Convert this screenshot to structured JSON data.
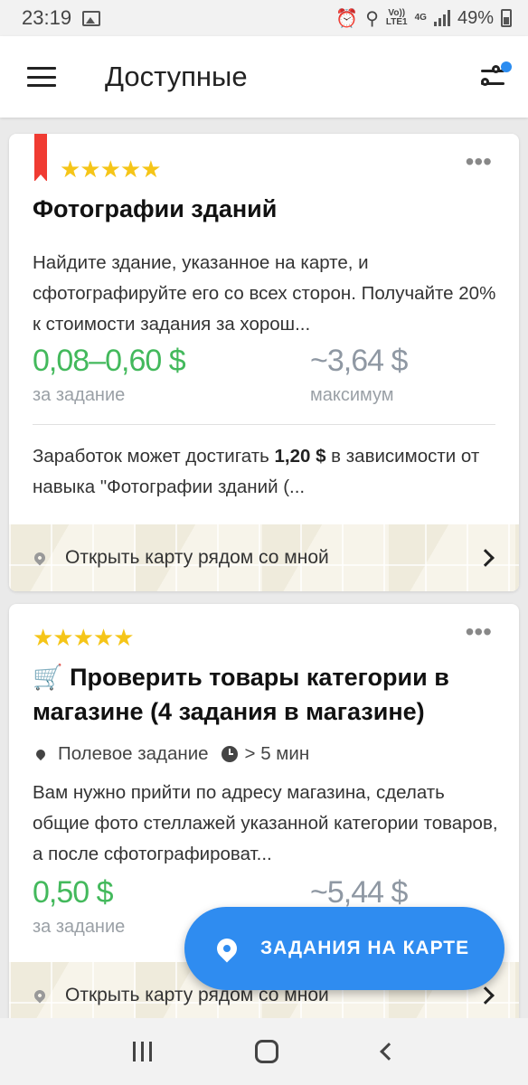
{
  "status_bar": {
    "time": "23:19",
    "network_top": "Vo))",
    "network_bottom": "LTE1",
    "net_type": "4G",
    "battery": "49%"
  },
  "app_bar": {
    "title": "Доступные"
  },
  "cards": [
    {
      "stars": "★★★★★",
      "title": "Фотографии зданий",
      "description": "Найдите здание, указанное на карте, и сфотографируйте его со всех сторон. Получайте 20% к стоимости задания за хорош...",
      "price": "0,08–0,60 $",
      "price_label": "за задание",
      "max_price": "~3,64 $",
      "max_label": "максимум",
      "earn_prefix": "Заработок может достигать ",
      "earn_amount": "1,20 $",
      "earn_suffix": " в зависимости от навыка \"Фотографии зданий (...",
      "map_link": "Открыть карту рядом со мной"
    },
    {
      "stars": "★★★★★",
      "title": "🛒 Проверить товары категории в магазине (4 задания в магазине)",
      "meta_type": "Полевое задание",
      "meta_time": "> 5 мин",
      "description": "Вам нужно прийти по адресу магазина, сделать общие фото стеллажей указанной категории товаров, а после сфотографироват...",
      "price": "0,50 $",
      "price_label": "за задание",
      "max_price": "~5,44 $",
      "map_link": "Открыть карту рядом со мной"
    }
  ],
  "fab": {
    "label": "ЗАДАНИЯ НА КАРТЕ"
  },
  "colors": {
    "price_green": "#43b95c",
    "accent_blue": "#2f8cf0",
    "star_yellow": "#f5c518",
    "bookmark_red": "#f03b32"
  }
}
